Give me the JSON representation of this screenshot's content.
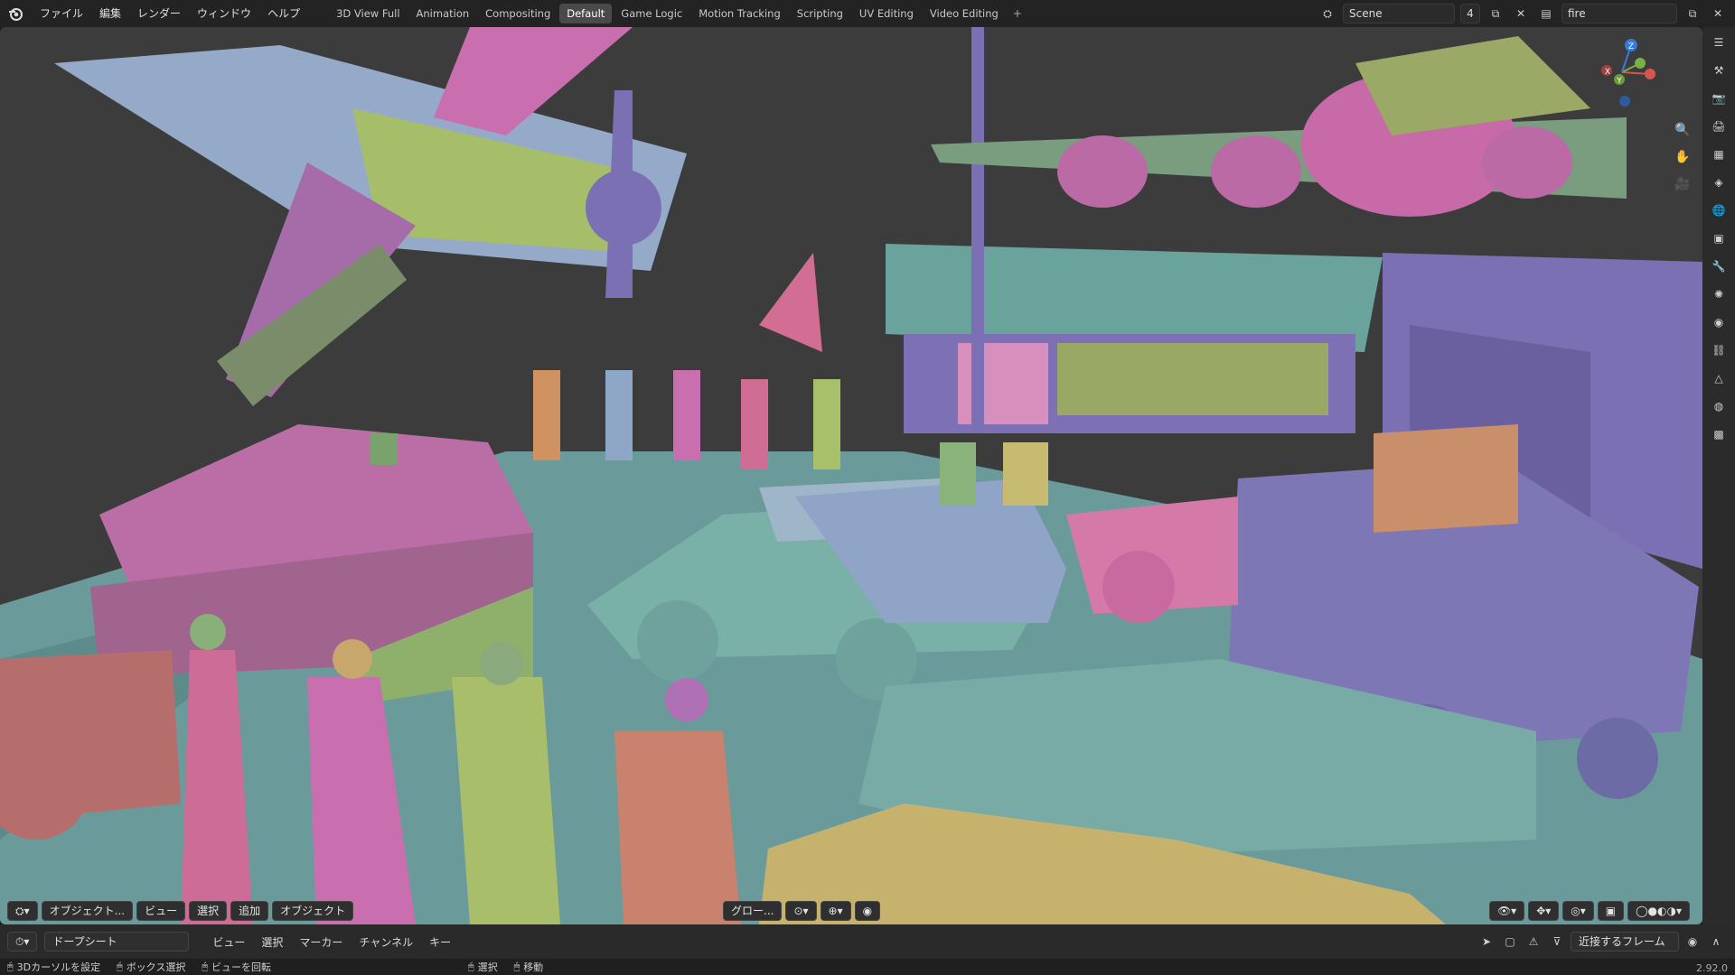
{
  "menu": [
    "ファイル",
    "編集",
    "レンダー",
    "ウィンドウ",
    "ヘルプ"
  ],
  "tabs": [
    {
      "label": "3D View Full"
    },
    {
      "label": "Animation"
    },
    {
      "label": "Compositing"
    },
    {
      "label": "Default",
      "active": true
    },
    {
      "label": "Game Logic"
    },
    {
      "label": "Motion Tracking"
    },
    {
      "label": "Scripting"
    },
    {
      "label": "UV Editing"
    },
    {
      "label": "Video Editing"
    }
  ],
  "scene": {
    "name": "Scene",
    "count": "4",
    "view_layer": "fire"
  },
  "viewport_header": {
    "mode": "オブジェクト...",
    "view": "ビュー",
    "select": "選択",
    "add": "追加",
    "object": "オブジェクト",
    "orientation": "グロー..."
  },
  "timeline": {
    "editor": "ドープシート",
    "menu": [
      "ビュー",
      "選択",
      "マーカー",
      "チャンネル",
      "キー"
    ],
    "snap": "近接するフレーム"
  },
  "status": {
    "items": [
      "3Dカーソルを設定",
      "ボックス選択",
      "ビューを回転",
      "選択",
      "移動"
    ],
    "version": "2.92.0"
  },
  "gizmo_axes": {
    "x": "X",
    "y": "Y",
    "z": "Z"
  },
  "icons": {
    "logo": "blender-logo-icon",
    "zoom": "zoom-icon",
    "pan": "hand-icon",
    "camera": "camera-icon"
  }
}
